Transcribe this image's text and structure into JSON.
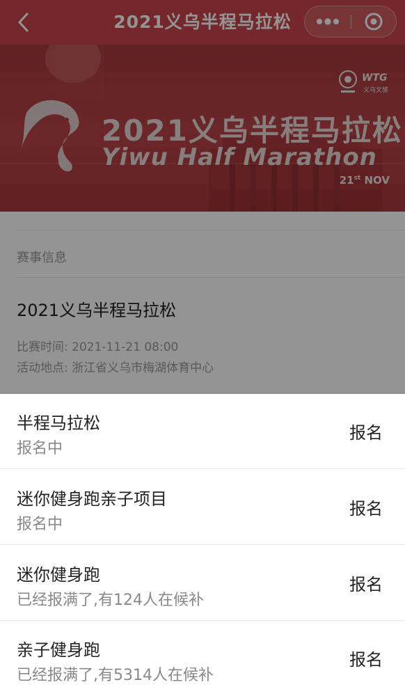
{
  "navbar": {
    "title": "2021义乌半程马拉松",
    "back_icon": "chevron-left-icon",
    "more_icon": "more-dots-icon",
    "close_icon": "target-close-icon"
  },
  "banner": {
    "title": "2021义乌半程马拉松",
    "subtitle": "Yiwu Half Marathon",
    "date_day": "21",
    "date_suffix": "st",
    "date_month": "NOV",
    "logo_text": "WTG",
    "logo_sub": "义乌文旅"
  },
  "info": {
    "section_label": "赛事信息",
    "event_name": "2021义乌半程马拉松",
    "time_label": "比赛时间: ",
    "time_value": "2021-11-21 08:00",
    "place_label": "活动地点: ",
    "place_value": "浙江省义乌市梅湖体育中心"
  },
  "items": [
    {
      "name": "半程马拉松",
      "status": "报名中",
      "action": "报名"
    },
    {
      "name": "迷你健身跑亲子项目",
      "status": "报名中",
      "action": "报名"
    },
    {
      "name": "迷你健身跑",
      "status": "已经报满了,有124人在候补",
      "action": "报名"
    },
    {
      "name": "亲子健身跑",
      "status": "已经报满了,有5314人在候补",
      "action": "报名"
    }
  ],
  "colors": {
    "navbar": "#c8464a",
    "banner": "#b94347"
  }
}
